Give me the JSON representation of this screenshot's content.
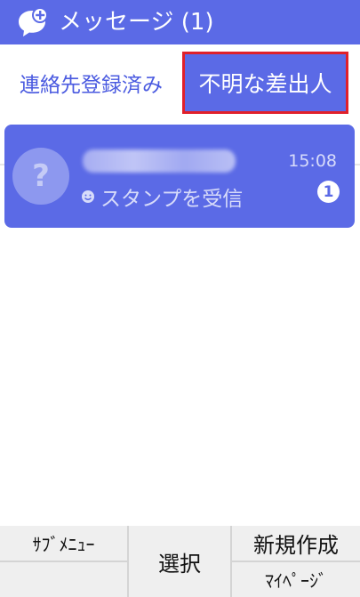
{
  "header": {
    "title": "メッセージ (1)",
    "icon": "chat-bubble-plus-icon"
  },
  "tabs": {
    "contacts_label": "連絡先登録済み",
    "unknown_label": "不明な差出人"
  },
  "message": {
    "time": "15:08",
    "preview": "スタンプを受信",
    "unread_count": "1",
    "avatar_glyph": "?"
  },
  "softkeys": {
    "submenu": "ｻﾌﾞﾒﾆｭｰ",
    "select": "選択",
    "new": "新規作成",
    "mypage": "ﾏｲﾍﾟｰｼﾞ"
  },
  "colors": {
    "accent": "#5b6ae6",
    "highlight": "#e0202a"
  }
}
